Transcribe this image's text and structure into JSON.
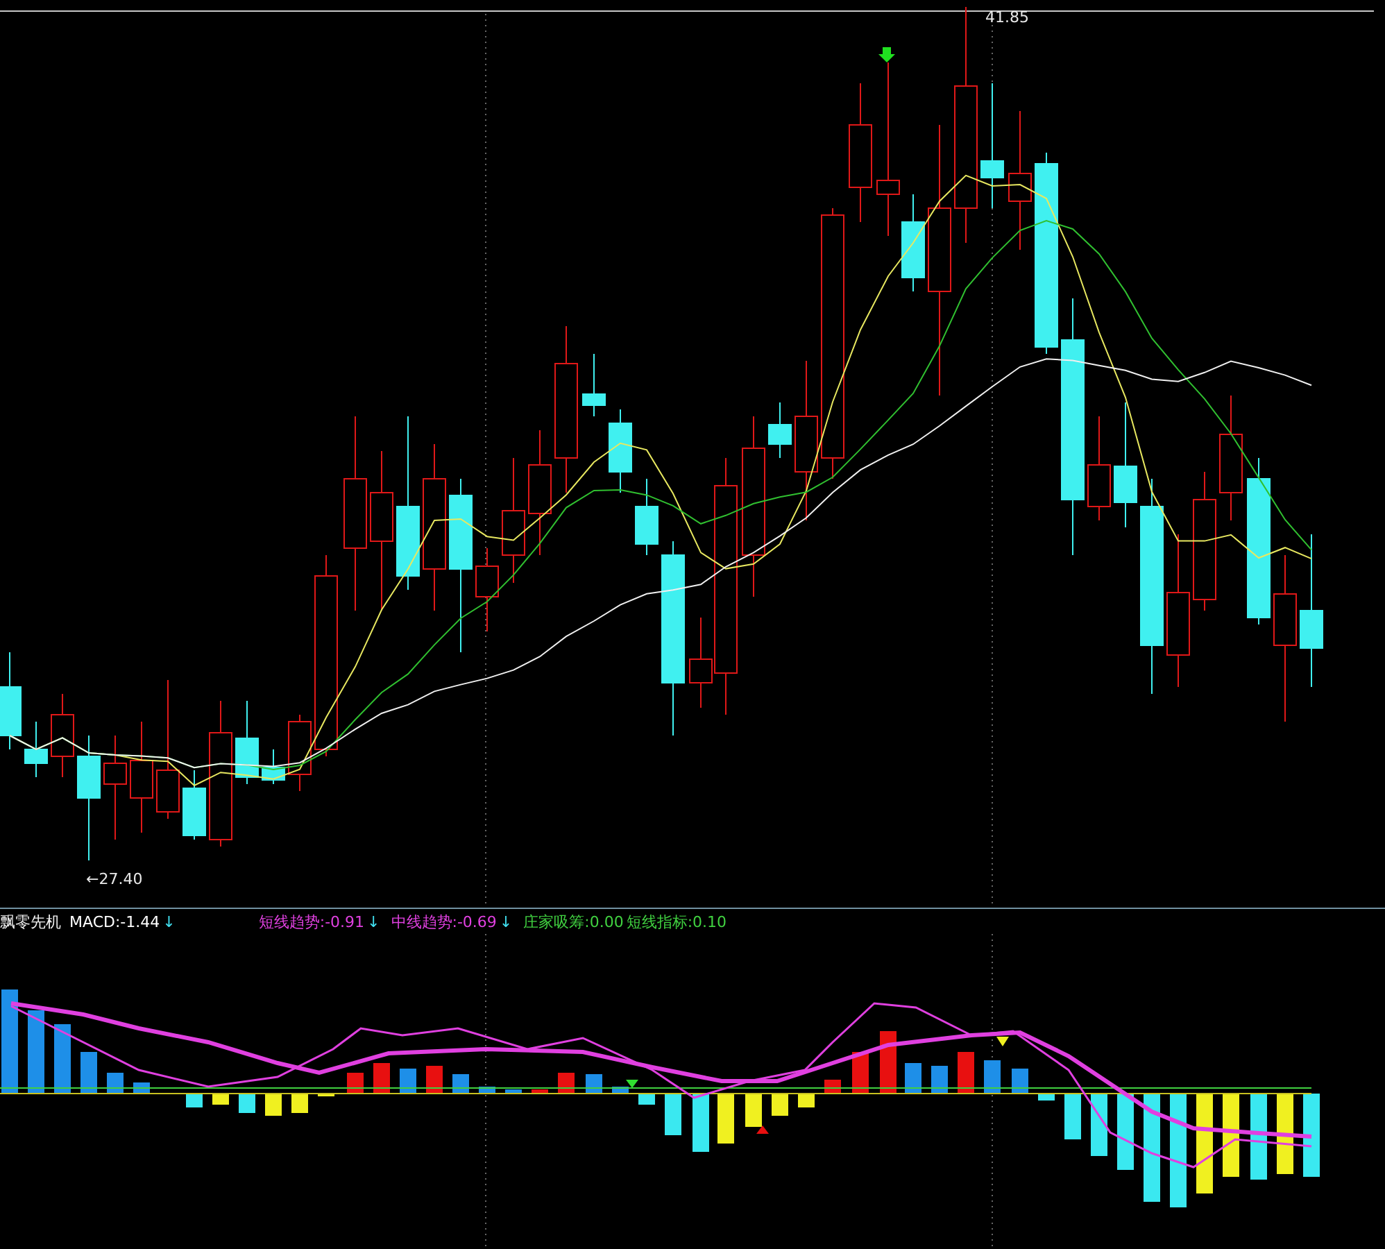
{
  "price_chart": {
    "high_label": "41.85",
    "low_label": "←27.40"
  },
  "indicator": {
    "name": "飘零先机",
    "items": [
      {
        "label": "MACD:-1.44",
        "arrow": "↓",
        "color": "#ffffff"
      },
      {
        "label": "短线趋势:-0.91",
        "arrow": "↓",
        "color": "#e040e0"
      },
      {
        "label": "中线趋势:-0.69",
        "arrow": "↓",
        "color": "#e040e0"
      },
      {
        "label": "庄家吸筹:0.00",
        "color": "#40d040"
      },
      {
        "label": "短线指标:0.10",
        "color": "#40d040"
      }
    ]
  }
}
